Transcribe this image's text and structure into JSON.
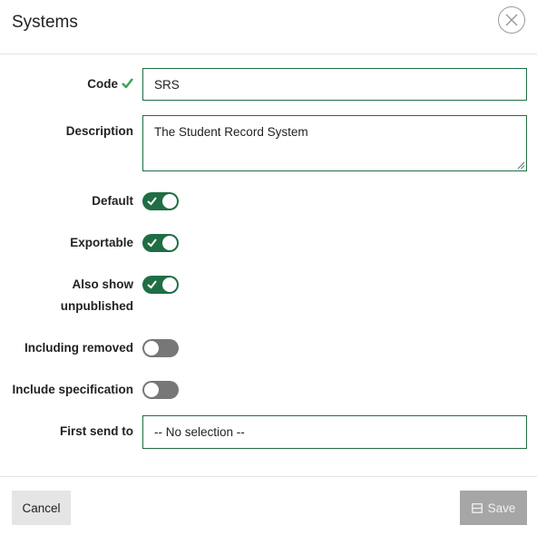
{
  "dialog": {
    "title": "Systems"
  },
  "form": {
    "code": {
      "label": "Code",
      "value": "SRS"
    },
    "description": {
      "label": "Description",
      "value": "The Student Record System"
    },
    "default": {
      "label": "Default",
      "checked": true
    },
    "exportable": {
      "label": "Exportable",
      "checked": true
    },
    "also_show_unpublished": {
      "label_line1": "Also show",
      "label_line2": "unpublished",
      "checked": true
    },
    "including_removed": {
      "label": "Including removed",
      "checked": false
    },
    "include_specification": {
      "label": "Include specification",
      "checked": false
    },
    "first_send_to": {
      "label": "First send to",
      "value": "-- No selection --"
    }
  },
  "footer": {
    "cancel_label": "Cancel",
    "save_label": "Save"
  },
  "colors": {
    "accent": "#1f6e43",
    "valid_check": "#3aa655",
    "toggle_off": "#777777",
    "save_disabled": "#a6a6a6"
  }
}
